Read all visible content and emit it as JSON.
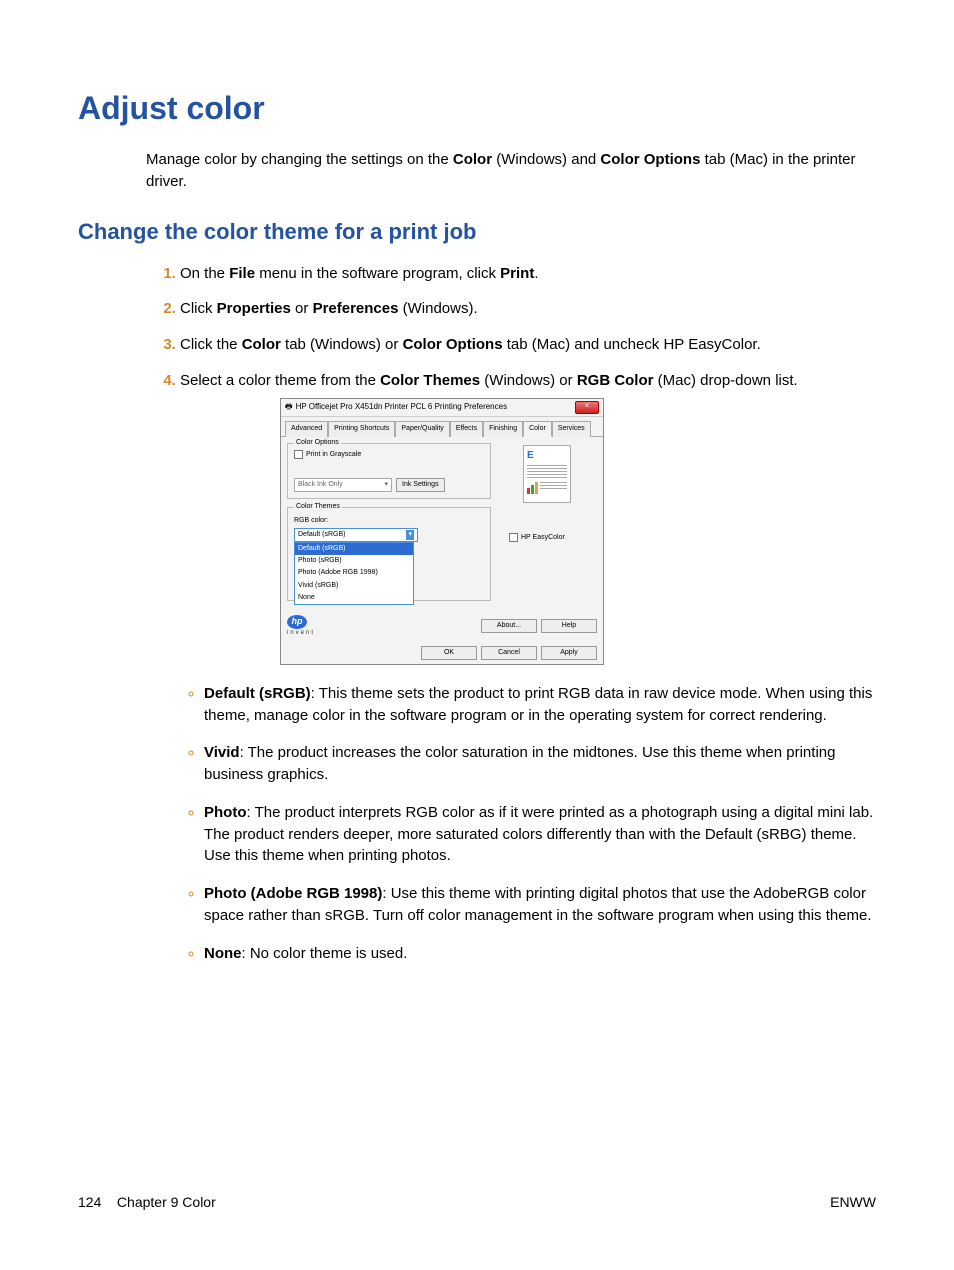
{
  "heading": "Adjust color",
  "intro_parts": {
    "p1": "Manage color by changing the settings on the ",
    "b1": "Color",
    "p2": " (Windows) and ",
    "b2": "Color Options",
    "p3": " tab (Mac) in the printer driver."
  },
  "subheading": "Change the color theme for a print job",
  "steps": {
    "s1": {
      "t1": "On the ",
      "b1": "File",
      "t2": " menu in the software program, click ",
      "b2": "Print",
      "t3": "."
    },
    "s2": {
      "t1": "Click ",
      "b1": "Properties",
      "t2": " or ",
      "b2": "Preferences",
      "t3": " (Windows)."
    },
    "s3": {
      "t1": "Click the ",
      "b1": "Color",
      "t2": " tab (Windows) or ",
      "b2": "Color Options",
      "t3": " tab (Mac) and uncheck HP EasyColor."
    },
    "s4": {
      "t1": "Select a color theme from the ",
      "b1": "Color Themes",
      "t2": " (Windows) or ",
      "b2": "RGB Color",
      "t3": " (Mac) drop-down list."
    }
  },
  "dialog": {
    "title": "HP Officejet Pro X451dn Printer PCL 6 Printing Preferences",
    "close": "×",
    "tabs": [
      "Advanced",
      "Printing Shortcuts",
      "Paper/Quality",
      "Effects",
      "Finishing",
      "Color",
      "Services"
    ],
    "active_tab_index": 5,
    "color_options": {
      "group": "Color Options",
      "print_grayscale": "Print in Grayscale",
      "black_ink": "Black Ink Only",
      "ink_settings": "Ink Settings"
    },
    "color_themes": {
      "group": "Color Themes",
      "label": "RGB color:",
      "selected": "Default (sRGB)",
      "options": [
        "Default (sRGB)",
        "Photo (sRGB)",
        "Photo (Adobe RGB 1998)",
        "Vivid (sRGB)",
        "None"
      ],
      "highlighted_index": 0
    },
    "easycolor": "HP EasyColor",
    "buttons": {
      "about": "About...",
      "help": "Help",
      "ok": "OK",
      "cancel": "Cancel",
      "apply": "Apply"
    },
    "logo_sub": "invent"
  },
  "bullets": {
    "b1": {
      "name": "Default (sRGB)",
      "text": ": This theme sets the product to print RGB data in raw device mode. When using this theme, manage color in the software program or in the operating system for correct rendering."
    },
    "b2": {
      "name": "Vivid",
      "text": ": The product increases the color saturation in the midtones. Use this theme when printing business graphics."
    },
    "b3": {
      "name": "Photo",
      "text": ": The product interprets RGB color as if it were printed as a photograph using a digital mini lab. The product renders deeper, more saturated colors differently than with the Default (sRBG) theme. Use this theme when printing photos."
    },
    "b4": {
      "name": "Photo (Adobe RGB 1998)",
      "text": ": Use this theme with printing digital photos that use the AdobeRGB color space rather than sRGB. Turn off color management in the software program when using this theme."
    },
    "b5": {
      "name": "None",
      "text": ": No color theme is used."
    }
  },
  "footer": {
    "page_num": "124",
    "chapter": "Chapter 9   Color",
    "right": "ENWW"
  }
}
